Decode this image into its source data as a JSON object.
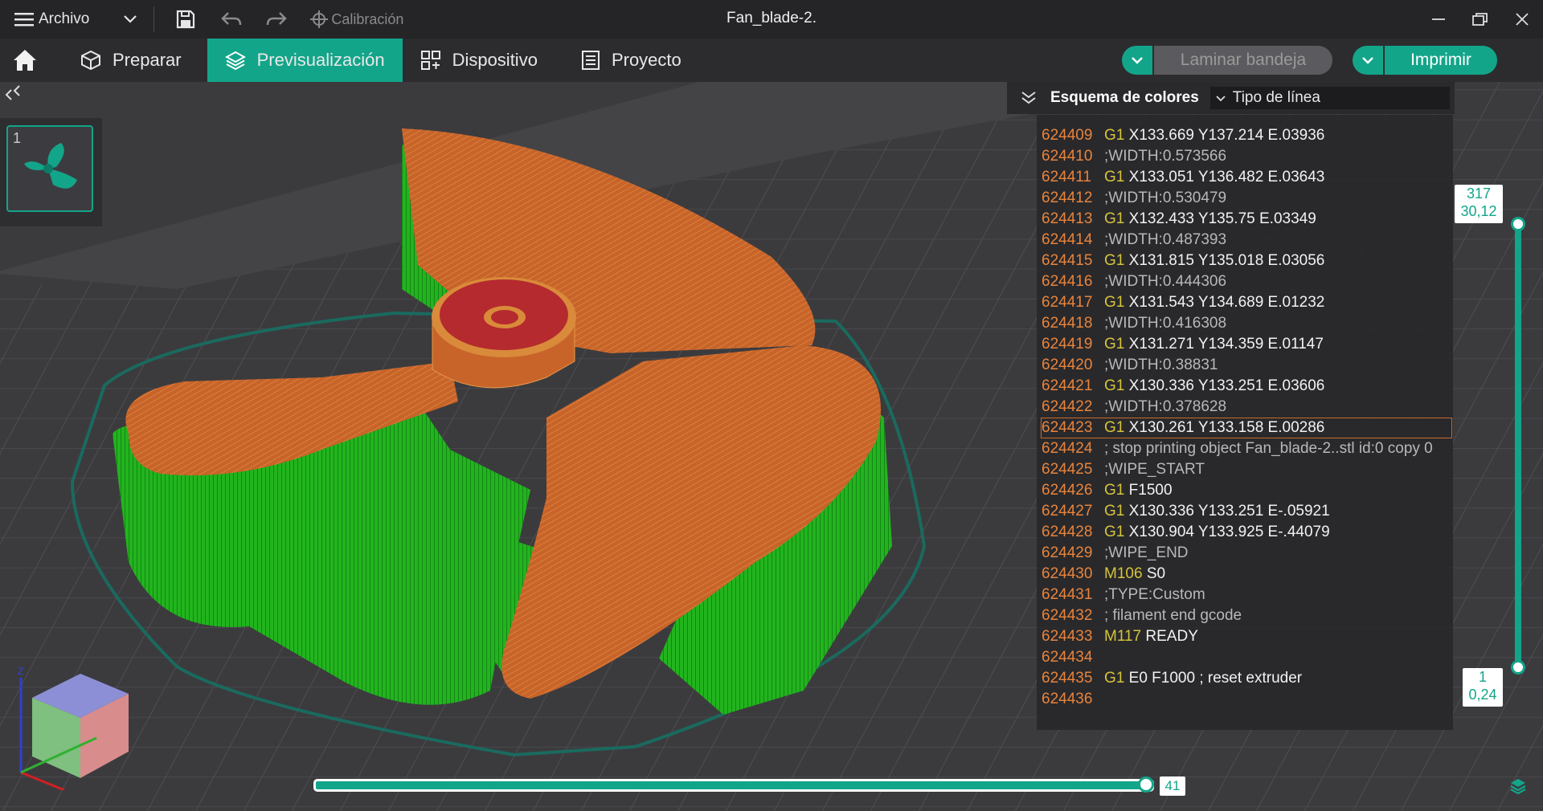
{
  "titlebar": {
    "menu_label": "Archivo",
    "calibration_label": "Calibración",
    "window_title": "Fan_blade-2."
  },
  "tabs": [
    {
      "label": "Preparar"
    },
    {
      "label": "Previsualización"
    },
    {
      "label": "Dispositivo"
    },
    {
      "label": "Proyecto"
    }
  ],
  "actions": {
    "slice_label": "Laminar bandeja",
    "print_label": "Imprimir"
  },
  "plate": {
    "number": "1"
  },
  "color_scheme": {
    "title": "Esquema de colores",
    "selected": "Tipo de línea"
  },
  "gcode_lines": [
    {
      "num": "624409",
      "cmd": "G1",
      "args": "X133.669 Y137.214 E.03936",
      "comment": ""
    },
    {
      "num": "624410",
      "cmd": "",
      "args": "",
      "comment": ";WIDTH:0.573566"
    },
    {
      "num": "624411",
      "cmd": "G1",
      "args": "X133.051 Y136.482 E.03643",
      "comment": ""
    },
    {
      "num": "624412",
      "cmd": "",
      "args": "",
      "comment": ";WIDTH:0.530479"
    },
    {
      "num": "624413",
      "cmd": "G1",
      "args": "X132.433 Y135.75 E.03349",
      "comment": ""
    },
    {
      "num": "624414",
      "cmd": "",
      "args": "",
      "comment": ";WIDTH:0.487393"
    },
    {
      "num": "624415",
      "cmd": "G1",
      "args": "X131.815 Y135.018 E.03056",
      "comment": ""
    },
    {
      "num": "624416",
      "cmd": "",
      "args": "",
      "comment": ";WIDTH:0.444306"
    },
    {
      "num": "624417",
      "cmd": "G1",
      "args": "X131.543 Y134.689 E.01232",
      "comment": ""
    },
    {
      "num": "624418",
      "cmd": "",
      "args": "",
      "comment": ";WIDTH:0.416308"
    },
    {
      "num": "624419",
      "cmd": "G1",
      "args": "X131.271 Y134.359 E.01147",
      "comment": ""
    },
    {
      "num": "624420",
      "cmd": "",
      "args": "",
      "comment": ";WIDTH:0.38831"
    },
    {
      "num": "624421",
      "cmd": "G1",
      "args": "X130.336 Y133.251 E.03606",
      "comment": ""
    },
    {
      "num": "624422",
      "cmd": "",
      "args": "",
      "comment": ";WIDTH:0.378628"
    },
    {
      "num": "624423",
      "cmd": "G1",
      "args": "X130.261 Y133.158 E.00286",
      "comment": ""
    },
    {
      "num": "624424",
      "cmd": "",
      "args": "",
      "comment": "; stop printing object Fan_blade-2..stl id:0 copy 0"
    },
    {
      "num": "624425",
      "cmd": "",
      "args": "",
      "comment": ";WIPE_START"
    },
    {
      "num": "624426",
      "cmd": "G1",
      "args": "F1500",
      "comment": ""
    },
    {
      "num": "624427",
      "cmd": "G1",
      "args": "X130.336 Y133.251 E-.05921",
      "comment": ""
    },
    {
      "num": "624428",
      "cmd": "G1",
      "args": "X130.904 Y133.925 E-.44079",
      "comment": ""
    },
    {
      "num": "624429",
      "cmd": "",
      "args": "",
      "comment": ";WIPE_END"
    },
    {
      "num": "624430",
      "cmd": "M106",
      "args": "S0",
      "comment": ""
    },
    {
      "num": "624431",
      "cmd": "",
      "args": "",
      "comment": ";TYPE:Custom"
    },
    {
      "num": "624432",
      "cmd": "",
      "args": "",
      "comment": "; filament end gcode"
    },
    {
      "num": "624433",
      "cmd": "M117",
      "args": "READY",
      "comment": ""
    },
    {
      "num": "624434",
      "cmd": "",
      "args": "",
      "comment": ""
    },
    {
      "num": "624435",
      "cmd": "G1",
      "args": "E0 F1000",
      "comment": "; reset extruder"
    },
    {
      "num": "624436",
      "cmd": "",
      "args": "",
      "comment": ""
    }
  ],
  "highlighted_line": "624423",
  "layer_slider": {
    "top_layer": "317",
    "top_height": "30,12",
    "bottom_layer": "1",
    "bottom_height": "0,24"
  },
  "move_slider": {
    "value": "41",
    "fraction": 1.0
  },
  "colors": {
    "accent": "#13a58a",
    "gcode_number": "#e8843c",
    "gcode_command": "#d6c43a",
    "wall": "#c8642a",
    "support": "#22b41e",
    "top_surface": "#b52a2e"
  },
  "axes": {
    "z": "Z",
    "x": "X",
    "y": "Y"
  }
}
